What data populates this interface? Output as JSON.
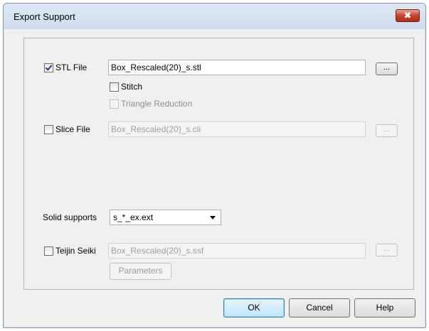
{
  "window": {
    "title": "Export Support",
    "close_label": "✖"
  },
  "stl": {
    "label": "STL File",
    "checked": true,
    "path": "Box_Rescaled(20)_s.stl",
    "browse_label": "...",
    "stitch_label": "Stitch",
    "triangle_reduction_label": "Triangle Reduction"
  },
  "slice": {
    "label": "Slice File",
    "checked": false,
    "path": "Box_Rescaled(20)_s.cli",
    "browse_label": "..."
  },
  "solid_supports": {
    "label": "Solid supports",
    "selected": "s_*_ex.ext"
  },
  "teijin": {
    "label": "Teijin Seiki",
    "checked": false,
    "path": "Box_Rescaled(20)_s.ssf",
    "browse_label": "...",
    "parameters_label": "Parameters"
  },
  "buttons": {
    "ok": "OK",
    "cancel": "Cancel",
    "help": "Help"
  }
}
